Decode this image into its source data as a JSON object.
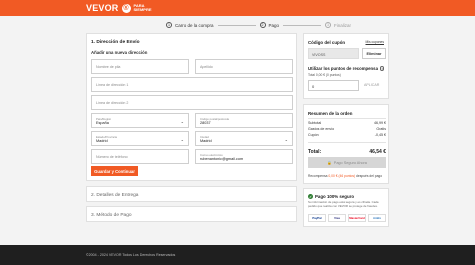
{
  "brand": {
    "name": "VEVOR",
    "badge": "®",
    "sub_line1": "PARA",
    "sub_line2": "SIEMPRE",
    "accent": "#f15a24"
  },
  "steps": [
    {
      "num": "1",
      "label": "Carro de la compra"
    },
    {
      "num": "2",
      "label": "Pago"
    },
    {
      "num": "3",
      "label": "Finalizar"
    }
  ],
  "shipping": {
    "title": "1. Dirección de Envío",
    "subtitle": "Añadir una nueva dirección",
    "first_name_placeholder": "Nombre de pila",
    "last_name_placeholder": "Apellido",
    "address1_placeholder": "Línea de dirección 1",
    "address2_placeholder": "Línea de dirección 2",
    "country_label": "País/Región",
    "country_value": "España",
    "zip_label": "Código postal/postcode",
    "zip_value": "28037",
    "province_label": "Estado/Provincia",
    "province_value": "Madrid",
    "city_label": "Ciudad",
    "city_value": "Madrid",
    "phone_placeholder": "Número de teléfono",
    "email_label": "Correo electrónico",
    "email_value": "rubenantonic@gmail.com",
    "save_button": "Guardar y Continuar"
  },
  "sections": {
    "delivery": "2. Detalles de Entrega",
    "payment": "3. Método de Pago"
  },
  "coupon": {
    "title": "Código del cupón",
    "my_coupons": "Mis cupones",
    "value": "VIVOSS",
    "apply": "Eliminar"
  },
  "points": {
    "title": "Utilizar los puntos de recompensa",
    "subtitle": "Total 0,00 € (0 puntos)",
    "value": "0",
    "apply": "APLICAR"
  },
  "summary": {
    "title": "Resumen de la orden",
    "rows": [
      {
        "label": "Subtotal",
        "value": "46,99 €"
      },
      {
        "label": "Gastos de envío",
        "value": "Gratis"
      },
      {
        "label": "Cupón",
        "value": "-0,45 €"
      }
    ],
    "total_label": "Total:",
    "total_value": "46,54 €",
    "pay_button": "Pago Seguro Ahora",
    "reward_prefix": "Recompensa",
    "reward_points": "0,00 € (46 puntos)",
    "reward_suffix": "después del pago"
  },
  "secure": {
    "title": "Pago 100% seguro",
    "text": "Su información de pago está segura y es cifrada. Cada pedido que realiza con VEVOR se protege de fraudes.",
    "logos": [
      "PayPal",
      "Visa",
      "MasterCard",
      "AmEx"
    ]
  },
  "footer": {
    "text": "©2004 - 2024 VEVOR Todos Los Derechos Reservados"
  }
}
